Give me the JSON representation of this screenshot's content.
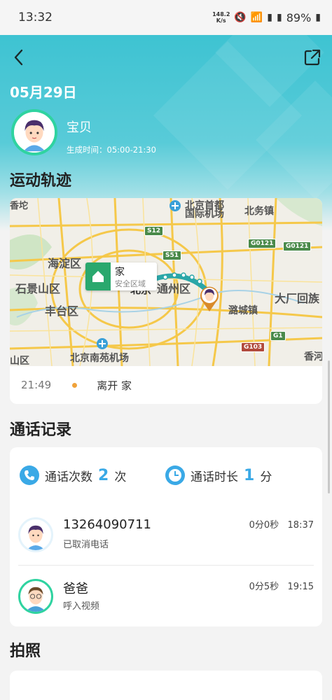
{
  "status_bar": {
    "time": "13:32",
    "net_speed_top": "148.2",
    "net_speed_bottom": "K/s",
    "battery": "89%"
  },
  "header": {
    "date": "05月29日",
    "child_name": "宝贝",
    "generated_time": "生成时间：05:00-21:30"
  },
  "sections": {
    "track_title": "运动轨迹",
    "calls_title": "通话记录",
    "photo_title": "拍照"
  },
  "map": {
    "labels": {
      "capital_airport": "北京首都",
      "capital_airport2": "国际机场",
      "beiwu": "北务镇",
      "haidian": "海淀区",
      "shijingshan": "石景山区",
      "fengtai": "丰台区",
      "tongzhou": "通州区",
      "dachang": "大厂回族",
      "lucheng": "潞城镇",
      "nanyuan": "北京南苑机场",
      "xiangshan": "香河",
      "shanqu": "山区",
      "xiangtuo": "香坨",
      "beijing": "北京"
    },
    "shields": [
      "S12",
      "S51",
      "G0121",
      "G0121",
      "G1",
      "G103"
    ],
    "home_pin": {
      "title": "家",
      "subtitle": "安全区域"
    }
  },
  "timeline": {
    "time": "21:49",
    "event": "离开 家"
  },
  "calls": {
    "count_label": "通话次数",
    "count_value": "2",
    "count_unit": "次",
    "duration_label": "通话时长",
    "duration_value": "1",
    "duration_unit": "分",
    "records": [
      {
        "name": "13264090711",
        "status": "已取消电话",
        "duration": "0分0秒",
        "time": "18:37"
      },
      {
        "name": "爸爸",
        "status": "呼入视频",
        "duration": "0分5秒",
        "time": "19:15"
      }
    ]
  },
  "colors": {
    "accent": "#3ec3d2",
    "blue": "#3aa9e6",
    "green": "#2fd3a0",
    "orange": "#f0a23a"
  }
}
